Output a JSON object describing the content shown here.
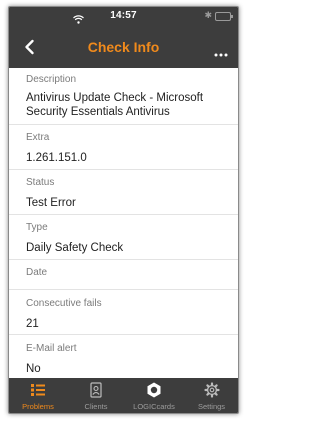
{
  "status_bar": {
    "time": "14:57"
  },
  "nav": {
    "title": "Check Info",
    "back_icon": "chevron-left-icon",
    "more_icon": "more-horizontal-icon"
  },
  "fields": [
    {
      "label": "Description",
      "value": "Antivirus Update Check - Microsoft Security Essentials Antivirus"
    },
    {
      "label": "Extra",
      "value": "1.261.151.0"
    },
    {
      "label": "Status",
      "value": "Test Error"
    },
    {
      "label": "Type",
      "value": "Daily Safety Check"
    },
    {
      "label": "Date",
      "value": ""
    },
    {
      "label": "Consecutive fails",
      "value": "21"
    },
    {
      "label": "E-Mail alert",
      "value": "No"
    }
  ],
  "tabs": [
    {
      "label": "Problems",
      "icon": "list-icon",
      "active": true
    },
    {
      "label": "Clients",
      "icon": "contact-icon",
      "active": false
    },
    {
      "label": "LOGICcards",
      "icon": "logiccards-icon",
      "active": false
    },
    {
      "label": "Settings",
      "icon": "gear-icon",
      "active": false
    }
  ],
  "colors": {
    "accent": "#f08a1c",
    "bar": "#3d3d3d",
    "inactive": "#9c9c9c"
  }
}
